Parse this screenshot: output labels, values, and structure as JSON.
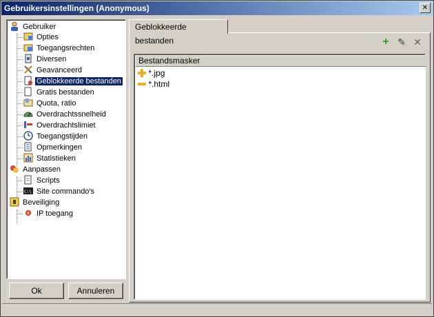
{
  "window": {
    "title": "Gebruikersinstellingen (Anonymous)",
    "close_glyph": "✕"
  },
  "tree": {
    "groups": [
      {
        "label": "Gebruiker",
        "icon": "user-icon",
        "items": [
          {
            "label": "Opties",
            "icon": "options-icon"
          },
          {
            "label": "Toegangsrechten",
            "icon": "access-rights-icon"
          },
          {
            "label": "Diversen",
            "icon": "misc-icon"
          },
          {
            "label": "Geavanceerd",
            "icon": "tools-icon"
          },
          {
            "label": "Geblokkeerde bestanden",
            "icon": "blocked-file-icon",
            "selected": true
          },
          {
            "label": "Gratis bestanden",
            "icon": "free-file-icon"
          },
          {
            "label": "Quota, ratio",
            "icon": "quota-icon"
          },
          {
            "label": "Overdrachtssnelheid",
            "icon": "speed-icon"
          },
          {
            "label": "Overdrachtslimiet",
            "icon": "limit-icon"
          },
          {
            "label": "Toegangstijden",
            "icon": "clock-icon"
          },
          {
            "label": "Opmerkingen",
            "icon": "notes-icon"
          },
          {
            "label": "Statistieken",
            "icon": "stats-icon"
          }
        ]
      },
      {
        "label": "Aanpassen",
        "icon": "customize-icon",
        "items": [
          {
            "label": "Scripts",
            "icon": "script-icon"
          },
          {
            "label": "Site commando's",
            "icon": "console-icon"
          }
        ]
      },
      {
        "label": "Beveiliging",
        "icon": "security-icon",
        "items": [
          {
            "label": "IP toegang",
            "icon": "ip-access-icon"
          }
        ]
      }
    ]
  },
  "buttons": {
    "ok": "Ok",
    "cancel": "Annuleren"
  },
  "tab": {
    "label": "Geblokkeerde bestanden"
  },
  "toolbar": {
    "add": "+",
    "edit": "✎",
    "delete": "✕"
  },
  "list": {
    "column": "Bestandsmasker",
    "rows": [
      {
        "mask": "*.jpg",
        "type": "include"
      },
      {
        "mask": "*.html",
        "type": "exclude"
      }
    ]
  }
}
